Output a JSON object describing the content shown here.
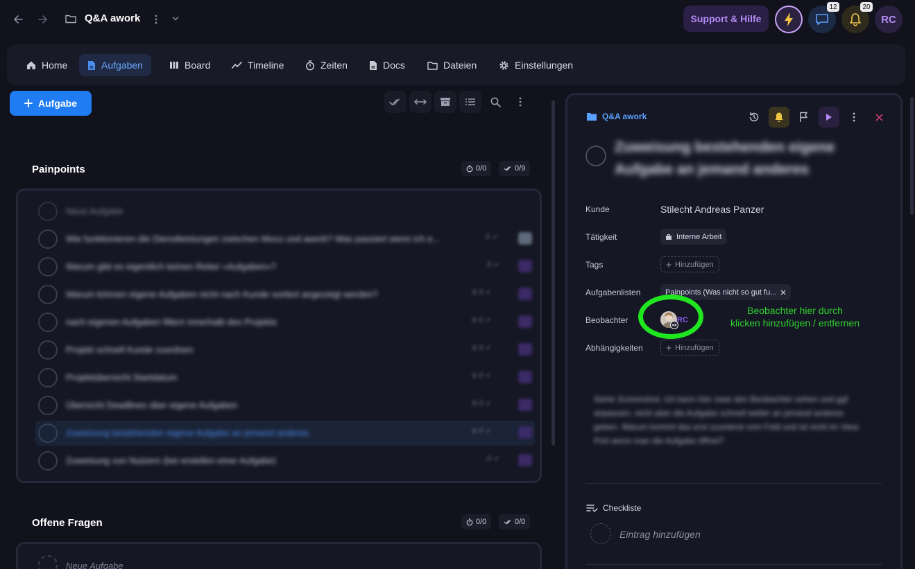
{
  "header": {
    "project_title": "Q&A awork",
    "support_label": "Support & Hilfe",
    "chat_badge": "12",
    "bell_badge": "20",
    "user_initials": "RC"
  },
  "tabs": [
    {
      "label": "Home",
      "icon": "home-icon"
    },
    {
      "label": "Aufgaben",
      "icon": "document-icon",
      "active": true
    },
    {
      "label": "Board",
      "icon": "board-icon"
    },
    {
      "label": "Timeline",
      "icon": "timeline-icon"
    },
    {
      "label": "Zeiten",
      "icon": "timer-icon"
    },
    {
      "label": "Docs",
      "icon": "doc-icon"
    },
    {
      "label": "Dateien",
      "icon": "folder-icon"
    },
    {
      "label": "Einstellungen",
      "icon": "gear-icon"
    }
  ],
  "toolbar": {
    "add_task_label": "Aufgabe"
  },
  "sections": [
    {
      "title": "Painpoints",
      "time": "0/0",
      "done": "0/9",
      "tasks": [
        {
          "text": "Neue Aufgabe"
        },
        {
          "text": "Wie funktionieren die Dienstleistungen zwischen Moco und awork? Was passiert wenn ich e..."
        },
        {
          "text": "Warum gibt es eigentlich keinen Reiter »Aufgaben«?"
        },
        {
          "text": "Warum können eigene Aufgaben nicht nach Kunde sortiert angezeigt werden?"
        },
        {
          "text": "nach eigenen Aufgaben filtern innerhalb des Projekts"
        },
        {
          "text": "Projekt schnell Kunde zuordnen"
        },
        {
          "text": "Projektübersicht Startdatum"
        },
        {
          "text": "Übersicht Deadlines über eigene Aufgaben"
        },
        {
          "text": "Zuweisung bestehenden eigene Aufgabe an jemand anderes"
        },
        {
          "text": "Zuweisung von Nutzern (bei erstellen einer Aufgabe)"
        }
      ]
    },
    {
      "title": "Offene Fragen",
      "time": "0/0",
      "done": "0/0",
      "new_task_placeholder": "Neue Aufgabe"
    }
  ],
  "detail": {
    "project_link": "Q&A awork",
    "title": "Zuweisung bestehenden eigene Aufgabe an jemand anderes",
    "fields": {
      "kunde_label": "Kunde",
      "kunde_value": "Stilecht Andreas Panzer",
      "taetigkeit_label": "Tätigkeit",
      "taetigkeit_value": "Interne Arbeit",
      "tags_label": "Tags",
      "tags_add": "Hinzufügen",
      "listen_label": "Aufgabenlisten",
      "listen_value": "Painpoints (Was nicht so gut fu...",
      "beobachter_label": "Beobachter",
      "beobachter_initials": "RC",
      "abh_label": "Abhängigkeiten",
      "abh_add": "Hinzufügen"
    },
    "description": "Siehe Screenshot. Ich kann hier zwar den Beobachter sehen und ggf anpassen, nicht aber die Aufgabe schnell weiter an jemand anderes geben. Warum kommt das erst zuunterst vom Feld und ist nicht im View Port wenn man die Aufgabe öffnet?",
    "checklist_label": "Checkliste",
    "checklist_placeholder": "Eintrag hinzufügen"
  },
  "annotation": {
    "line1": "Beobachter hier durch",
    "line2": "klicken hinzufügen / entfernen",
    "color": "#2ed12e"
  },
  "colors": {
    "accent": "#1f7cf2",
    "background": "#11121c",
    "purple": "#b48cf6"
  }
}
